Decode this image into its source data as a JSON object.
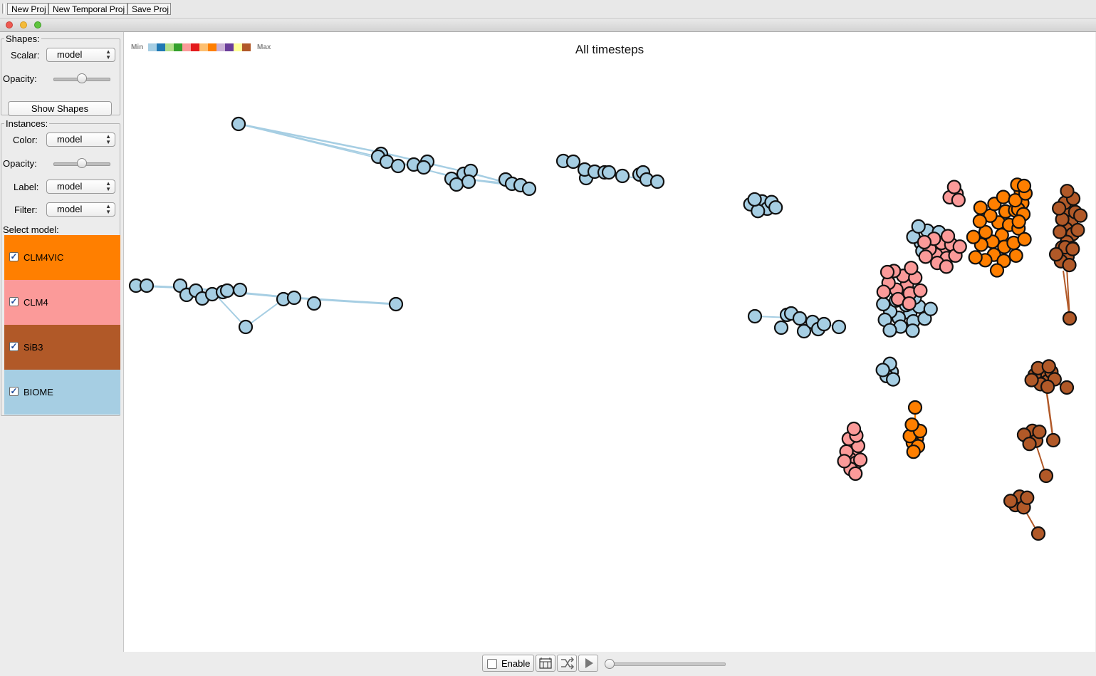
{
  "toolbar": {
    "new_proj": "New Proj",
    "new_temporal_proj": "New Temporal Proj",
    "save_proj": "Save Proj"
  },
  "shapes": {
    "title": "Shapes:",
    "scalar_label": "Scalar:",
    "scalar_value": "model",
    "opacity_label": "Opacity:",
    "opacity_level": 0.5,
    "show_button": "Show Shapes"
  },
  "instances": {
    "title": "Instances:",
    "color_label": "Color:",
    "color_value": "model",
    "opacity_label": "Opacity:",
    "opacity_level": 0.5,
    "label_label": "Label:",
    "label_value": "model",
    "filter_label": "Filter:",
    "filter_value": "model",
    "select_label": "Select model:",
    "models": [
      {
        "name": "CLM4VIC",
        "checked": true,
        "color": "#ff7f00"
      },
      {
        "name": "CLM4",
        "checked": true,
        "color": "#fb9a99"
      },
      {
        "name": "SiB3",
        "checked": true,
        "color": "#b15928"
      },
      {
        "name": "BIOME",
        "checked": true,
        "color": "#a6cee3"
      }
    ]
  },
  "canvas": {
    "title": "All timesteps",
    "legend_min": "Min",
    "legend_max": "Max",
    "legend_colors": [
      "#a6cee3",
      "#1f78b4",
      "#b2df8a",
      "#33a02c",
      "#fb9a99",
      "#e31a1c",
      "#fdbf6f",
      "#ff7f00",
      "#cab2d6",
      "#6a3d9a",
      "#ffff99",
      "#b15928"
    ]
  },
  "bottom": {
    "enable_label": "Enable",
    "enable_checked": false,
    "time_level": 0
  }
}
